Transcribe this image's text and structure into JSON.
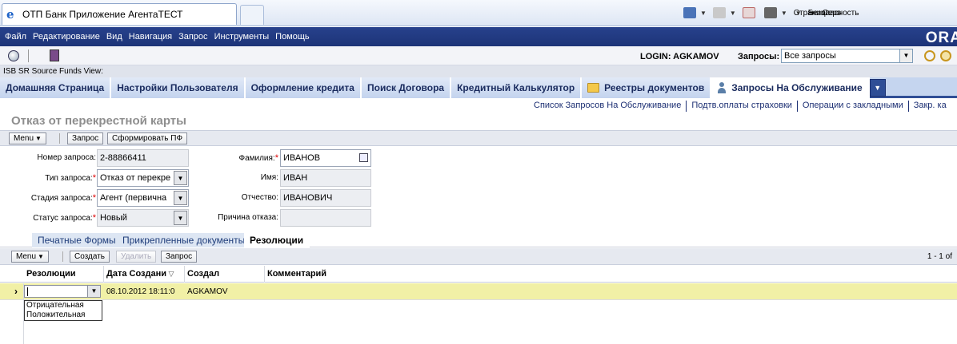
{
  "browser": {
    "tab_title": "ОТП Банк Приложение АгентаТЕСТ",
    "tools": {
      "page": "Страница",
      "security": "Безопасность",
      "service": "Серв"
    }
  },
  "menu": [
    "Файл",
    "Редактирование",
    "Вид",
    "Навигация",
    "Запрос",
    "Инструменты",
    "Помощь"
  ],
  "brand": "ORA",
  "toolbar": {
    "login": "LOGIN: AGKAMOV",
    "queries_label": "Запросы:",
    "queries_value": "Все запросы"
  },
  "view_label": "ISB SR Source Funds View:",
  "screen_tabs": [
    "Домашняя Страница",
    "Настройки Пользователя",
    "Оформление кредита",
    "Поиск Договора",
    "Кредитный Калькулятор",
    "Реестры документов",
    "Запросы На Обслуживание"
  ],
  "sub_links": [
    "Список Запросов На Обслуживание",
    "Подтв.оплаты страховки",
    "Операции с закладными",
    "Закр. ка"
  ],
  "form": {
    "title": "Отказ от перекрестной карты",
    "buttons": {
      "menu": "Menu",
      "query": "Запрос",
      "generate": "Сформировать ПФ"
    },
    "fields": {
      "request_no": {
        "label": "Номер запроса:",
        "value": "2-88866411"
      },
      "request_type": {
        "label": "Тип запроса:",
        "value": "Отказ от перекре"
      },
      "request_stage": {
        "label": "Стадия запроса:",
        "value": "Агент (первична"
      },
      "request_status": {
        "label": "Статус запроса:",
        "value": "Новый"
      },
      "surname": {
        "label": "Фамилия:",
        "value": "ИВАНОВ"
      },
      "name": {
        "label": "Имя:",
        "value": "ИВАН"
      },
      "patronymic": {
        "label": "Отчество:",
        "value": "ИВАНОВИЧ"
      },
      "reject_reason": {
        "label": "Причина отказа:",
        "value": ""
      }
    }
  },
  "sub_tabs": [
    "Печатные Формы",
    "Прикрепленные документы",
    "Резолюции"
  ],
  "list": {
    "buttons": {
      "menu": "Menu",
      "create": "Создать",
      "delete": "Удалить",
      "query": "Запрос"
    },
    "pager": "1 - 1 of",
    "columns": [
      "Резолюции",
      "Дата Создани",
      "Создал",
      "Комментарий"
    ],
    "row": {
      "resolution": "",
      "created": "08.10.2012 18:11:0",
      "author": "AGKAMOV",
      "comment": ""
    },
    "dropdown_options": [
      "Отрицательная",
      "Положительная"
    ]
  }
}
